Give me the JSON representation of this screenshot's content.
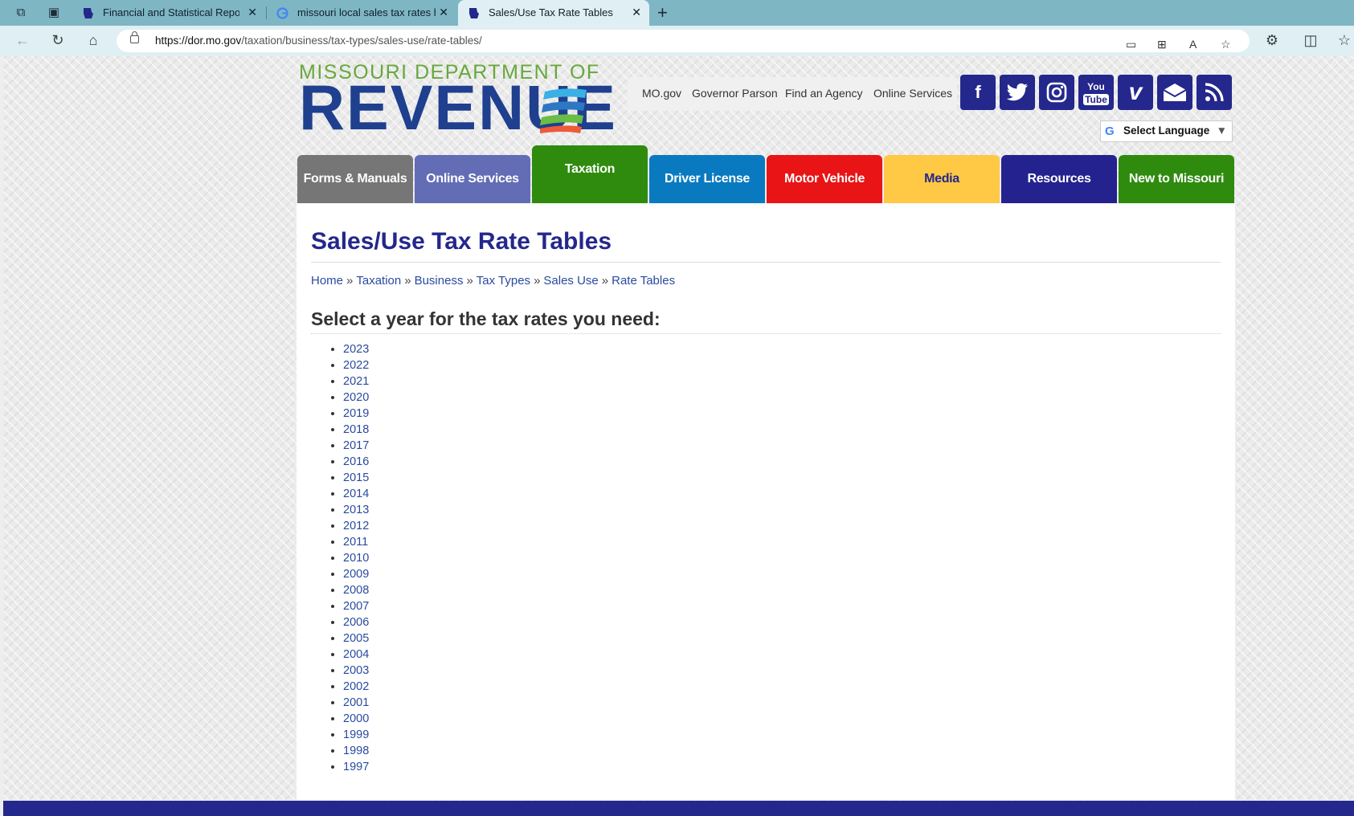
{
  "browser": {
    "tabs": [
      {
        "title": "Financial and Statistical Report",
        "favicon": "mo-state-icon"
      },
      {
        "title": "missouri local sales tax rates hist",
        "favicon": "google-icon"
      },
      {
        "title": "Sales/Use Tax Rate Tables",
        "favicon": "mo-state-icon"
      }
    ],
    "url_host": "https://dor.mo.gov",
    "url_path": "/taxation/business/tax-types/sales-use/rate-tables/"
  },
  "header": {
    "logo_top": "MISSOURI DEPARTMENT OF",
    "logo_main": "REVENUE",
    "util_links": [
      "MO.gov",
      "Governor Parson",
      "Find an Agency",
      "Online Services"
    ],
    "social": [
      "facebook-icon",
      "twitter-icon",
      "instagram-icon",
      "youtube-icon",
      "vimeo-icon",
      "email-icon",
      "rss-icon"
    ],
    "language": "Select Language"
  },
  "nav": [
    {
      "label": "Forms & Manuals",
      "color": "#767676"
    },
    {
      "label": "Online Services",
      "color": "#636db5"
    },
    {
      "label": "Taxation",
      "color": "#2e8b0e"
    },
    {
      "label": "Driver License",
      "color": "#0a7ac0"
    },
    {
      "label": "Motor Vehicle",
      "color": "#e81416"
    },
    {
      "label": "Media",
      "color": "#ffc845"
    },
    {
      "label": "Resources",
      "color": "#24228f"
    },
    {
      "label": "New to Missouri",
      "color": "#2e8b0e"
    }
  ],
  "main": {
    "title": "Sales/Use Tax Rate Tables",
    "breadcrumb": [
      "Home",
      "Taxation",
      "Business",
      "Tax Types",
      "Sales Use",
      "Rate Tables"
    ],
    "subtitle": "Select a year for the tax rates you need:",
    "years": [
      "2023",
      "2022",
      "2021",
      "2020",
      "2019",
      "2018",
      "2017",
      "2016",
      "2015",
      "2014",
      "2013",
      "2012",
      "2011",
      "2010",
      "2009",
      "2008",
      "2007",
      "2006",
      "2005",
      "2004",
      "2003",
      "2002",
      "2001",
      "2000",
      "1999",
      "1998",
      "1997"
    ]
  }
}
